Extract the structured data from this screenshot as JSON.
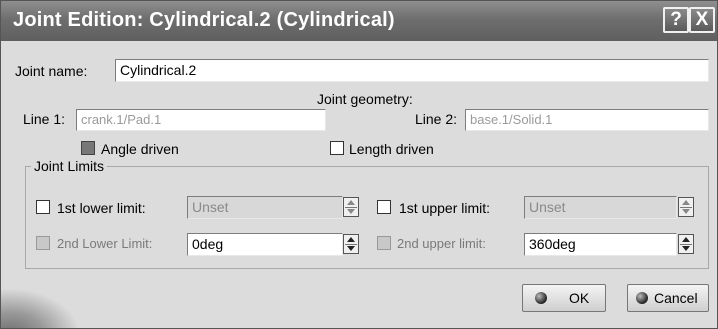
{
  "window": {
    "title": "Joint Edition: Cylindrical.2 (Cylindrical)",
    "help_label": "?",
    "close_label": "X"
  },
  "joint_name": {
    "label": "Joint name:",
    "value": "Cylindrical.2"
  },
  "joint_geometry": {
    "heading": "Joint geometry:",
    "line1_label": "Line 1:",
    "line1_value": "crank.1/Pad.1",
    "line2_label": "Line 2:",
    "line2_value": "base.1/Solid.1"
  },
  "drive": {
    "angle_driven_label": "Angle driven",
    "angle_driven_checked": true,
    "length_driven_label": "Length driven",
    "length_driven_checked": false
  },
  "joint_limits": {
    "title": "Joint Limits",
    "lower1_label": "1st lower limit:",
    "lower1_value": "Unset",
    "upper1_label": "1st upper limit:",
    "upper1_value": "Unset",
    "lower2_label": "2nd Lower Limit:",
    "lower2_value": "0deg",
    "upper2_label": "2nd upper limit:",
    "upper2_value": "360deg"
  },
  "buttons": {
    "ok_label": "OK",
    "cancel_label": "Cancel"
  }
}
